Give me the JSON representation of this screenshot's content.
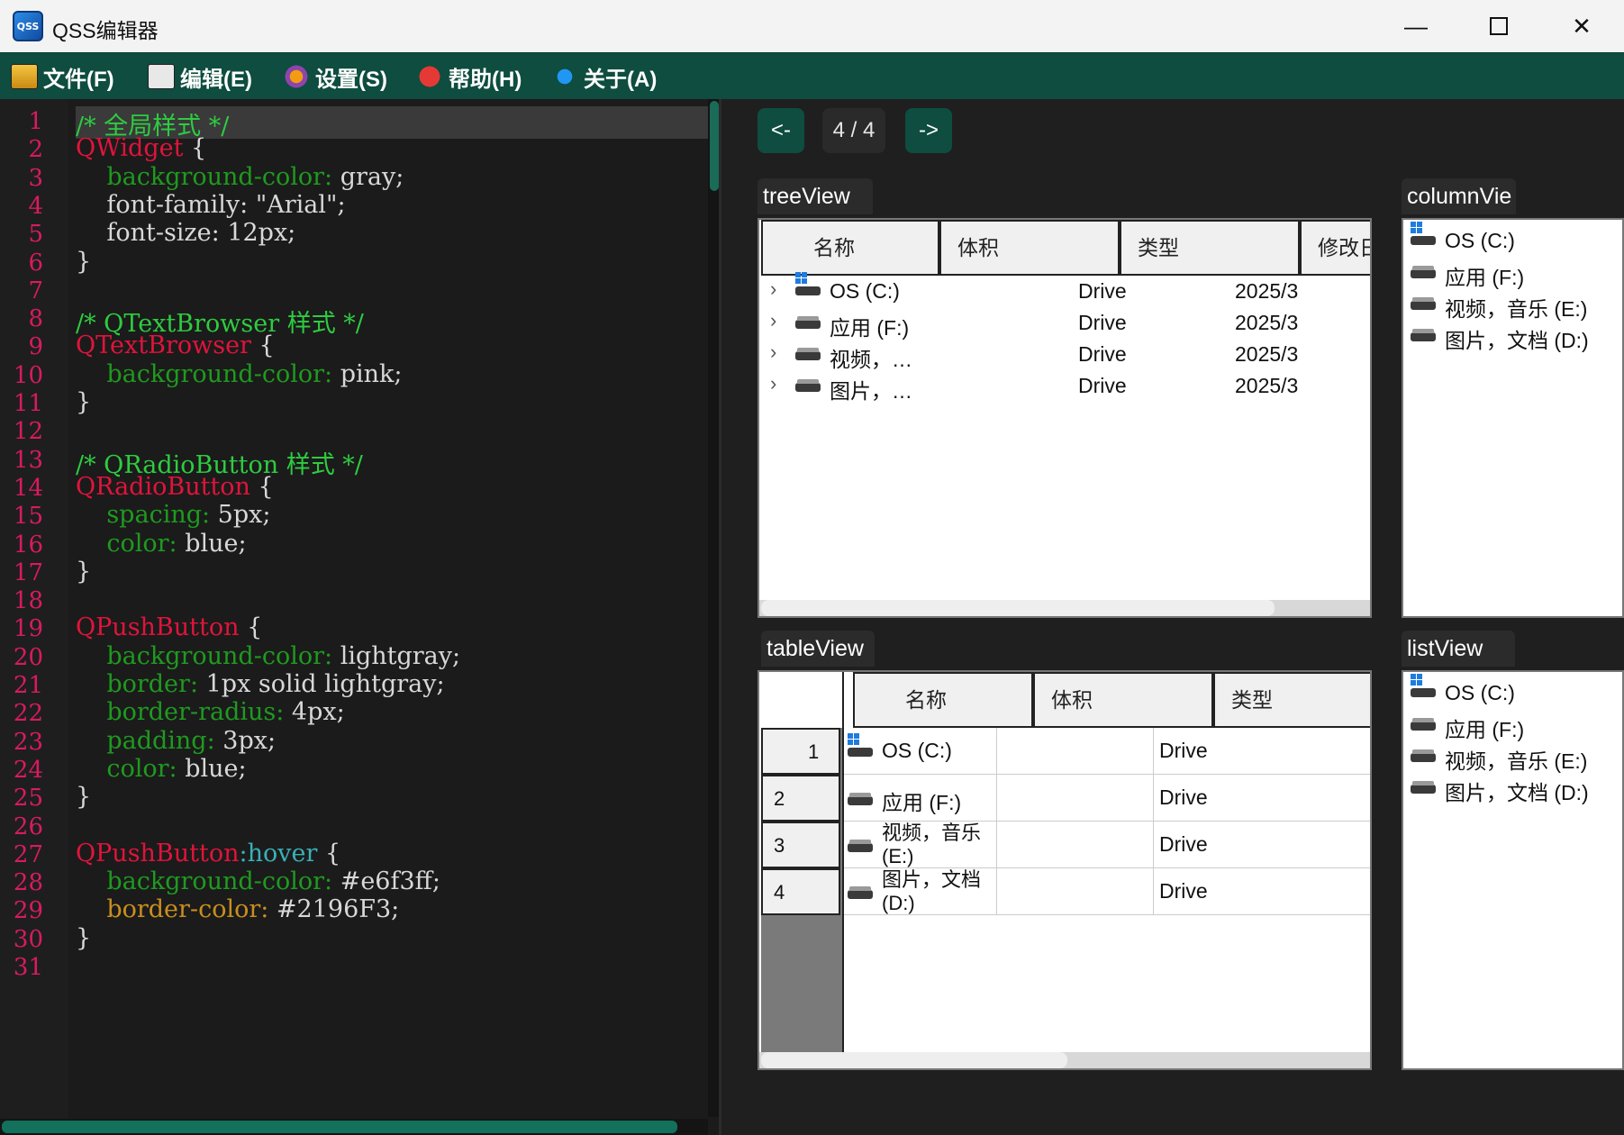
{
  "window": {
    "title": "QSS编辑器",
    "icon_text": "QSS"
  },
  "menu": [
    {
      "label": "文件(F)",
      "icon": "folder-icon"
    },
    {
      "label": "编辑(E)",
      "icon": "edit-icon"
    },
    {
      "label": "设置(S)",
      "icon": "gear-icon"
    },
    {
      "label": "帮助(H)",
      "icon": "help-icon"
    },
    {
      "label": "关于(A)",
      "icon": "about-icon"
    }
  ],
  "editor": {
    "line_numbers": [
      "1",
      "2",
      "3",
      "4",
      "5",
      "6",
      "7",
      "8",
      "9",
      "10",
      "11",
      "12",
      "13",
      "14",
      "15",
      "16",
      "17",
      "18",
      "19",
      "20",
      "21",
      "22",
      "23",
      "24",
      "25",
      "26",
      "27",
      "28",
      "29",
      "30",
      "31"
    ],
    "lines": [
      [
        {
          "t": "/* 全局样式 */",
          "c": "comment"
        }
      ],
      [
        {
          "t": "QWidget",
          "c": "sel"
        },
        {
          "t": " {",
          "c": "val"
        }
      ],
      [
        {
          "t": "    background-color:",
          "c": "prop"
        },
        {
          "t": " gray;",
          "c": "val"
        }
      ],
      [
        {
          "t": "    font-family: \"Arial\";",
          "c": "val"
        }
      ],
      [
        {
          "t": "    font-size: 12px;",
          "c": "val"
        }
      ],
      [
        {
          "t": "}",
          "c": "val"
        }
      ],
      [],
      [
        {
          "t": "/* QTextBrowser 样式 */",
          "c": "comment"
        }
      ],
      [
        {
          "t": "QTextBrowser",
          "c": "sel"
        },
        {
          "t": " {",
          "c": "val"
        }
      ],
      [
        {
          "t": "    background-color:",
          "c": "prop"
        },
        {
          "t": " pink;",
          "c": "val"
        }
      ],
      [
        {
          "t": "}",
          "c": "val"
        }
      ],
      [],
      [
        {
          "t": "/* QRadioButton 样式 */",
          "c": "comment"
        }
      ],
      [
        {
          "t": "QRadioButton",
          "c": "sel"
        },
        {
          "t": " {",
          "c": "val"
        }
      ],
      [
        {
          "t": "    spacing:",
          "c": "prop"
        },
        {
          "t": " 5px;",
          "c": "val"
        }
      ],
      [
        {
          "t": "    color:",
          "c": "prop"
        },
        {
          "t": " blue;",
          "c": "val"
        }
      ],
      [
        {
          "t": "}",
          "c": "val"
        }
      ],
      [],
      [
        {
          "t": "QPushButton",
          "c": "sel"
        },
        {
          "t": " {",
          "c": "val"
        }
      ],
      [
        {
          "t": "    background-color:",
          "c": "prop"
        },
        {
          "t": " lightgray;",
          "c": "val"
        }
      ],
      [
        {
          "t": "    border:",
          "c": "prop"
        },
        {
          "t": " 1px solid lightgray;",
          "c": "val"
        }
      ],
      [
        {
          "t": "    border-radius:",
          "c": "prop"
        },
        {
          "t": " 4px;",
          "c": "val"
        }
      ],
      [
        {
          "t": "    padding:",
          "c": "prop"
        },
        {
          "t": " 3px;",
          "c": "val"
        }
      ],
      [
        {
          "t": "    color:",
          "c": "prop"
        },
        {
          "t": " blue;",
          "c": "val"
        }
      ],
      [
        {
          "t": "}",
          "c": "val"
        }
      ],
      [],
      [
        {
          "t": "QPushButton",
          "c": "sel"
        },
        {
          "t": ":hover",
          "c": "pseudo"
        },
        {
          "t": " {",
          "c": "val"
        }
      ],
      [
        {
          "t": "    background-color:",
          "c": "prop"
        },
        {
          "t": " #e6f3ff;",
          "c": "val"
        }
      ],
      [
        {
          "t": "    border-color:",
          "c": "prop2"
        },
        {
          "t": " #2196F3;",
          "c": "val"
        }
      ],
      [
        {
          "t": "}",
          "c": "val"
        }
      ],
      []
    ]
  },
  "nav": {
    "prev": "<-",
    "page": "4 / 4",
    "next": "->"
  },
  "tree_view": {
    "title": "treeView",
    "headers": [
      "名称",
      "体积",
      "类型",
      "修改日"
    ],
    "rows": [
      {
        "name": "OS (C:)",
        "type": "Drive",
        "date": "2025/3",
        "icon": "windows-drive-icon"
      },
      {
        "name": "应用 (F:)",
        "type": "Drive",
        "date": "2025/3",
        "icon": "drive-icon"
      },
      {
        "name": "视频，…",
        "type": "Drive",
        "date": "2025/3",
        "icon": "drive-icon"
      },
      {
        "name": "图片，…",
        "type": "Drive",
        "date": "2025/3",
        "icon": "drive-icon"
      }
    ]
  },
  "column_view": {
    "title": "columnVie",
    "items": [
      "OS (C:)",
      "应用 (F:)",
      "视频，音乐 (E:)",
      "图片，文档 (D:)"
    ]
  },
  "table_view": {
    "title": "tableView",
    "headers": [
      "名称",
      "体积",
      "类型"
    ],
    "rows": [
      {
        "num": "1",
        "name": "OS (C:)",
        "name2": "",
        "type": "Drive"
      },
      {
        "num": "2",
        "name": "应用 (F:)",
        "name2": "",
        "type": "Drive"
      },
      {
        "num": "3",
        "name": "视频，音乐",
        "name2": "(E:)",
        "type": "Drive"
      },
      {
        "num": "4",
        "name": "图片，文档",
        "name2": "(D:)",
        "type": "Drive"
      }
    ]
  },
  "list_view": {
    "title": "listView",
    "items": [
      "OS (C:)",
      "应用 (F:)",
      "视频，音乐 (E:)",
      "图片，文档 (D:)"
    ]
  },
  "colors": {
    "accent": "#0e4d3f",
    "line_number": "#d81b60",
    "comment": "#2ecc40",
    "selector": "#e0143c",
    "property": "#1f9a1f"
  }
}
